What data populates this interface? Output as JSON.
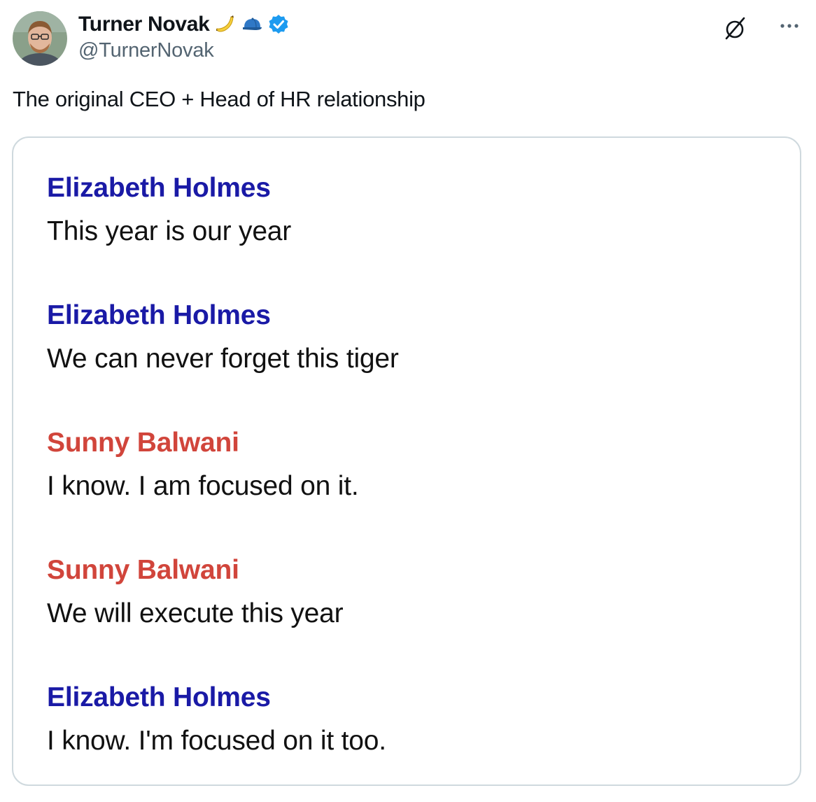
{
  "author": {
    "display_name": "Turner Novak",
    "handle": "@TurnerNovak",
    "badges": [
      "banana-emoji",
      "cap-emoji",
      "verified-badge-icon"
    ],
    "verified_color": "#1d9bf0"
  },
  "icons": {
    "grok": "grok-icon",
    "more": "more-options-icon"
  },
  "tweet": {
    "text": "The original CEO + Head of HR relationship"
  },
  "media": {
    "messages": [
      {
        "sender": "Elizabeth Holmes",
        "text": "This year is our year",
        "sender_color": "#1a1aa6"
      },
      {
        "sender": "Elizabeth Holmes",
        "text": "We can never forget this tiger",
        "sender_color": "#1a1aa6"
      },
      {
        "sender": "Sunny Balwani",
        "text": "I know. I am focused on it.",
        "sender_color": "#d1453b"
      },
      {
        "sender": "Sunny Balwani",
        "text": "We will execute this year",
        "sender_color": "#d1453b"
      },
      {
        "sender": "Elizabeth Holmes",
        "text": "I know. I'm focused on it too.",
        "sender_color": "#1a1aa6"
      }
    ]
  }
}
